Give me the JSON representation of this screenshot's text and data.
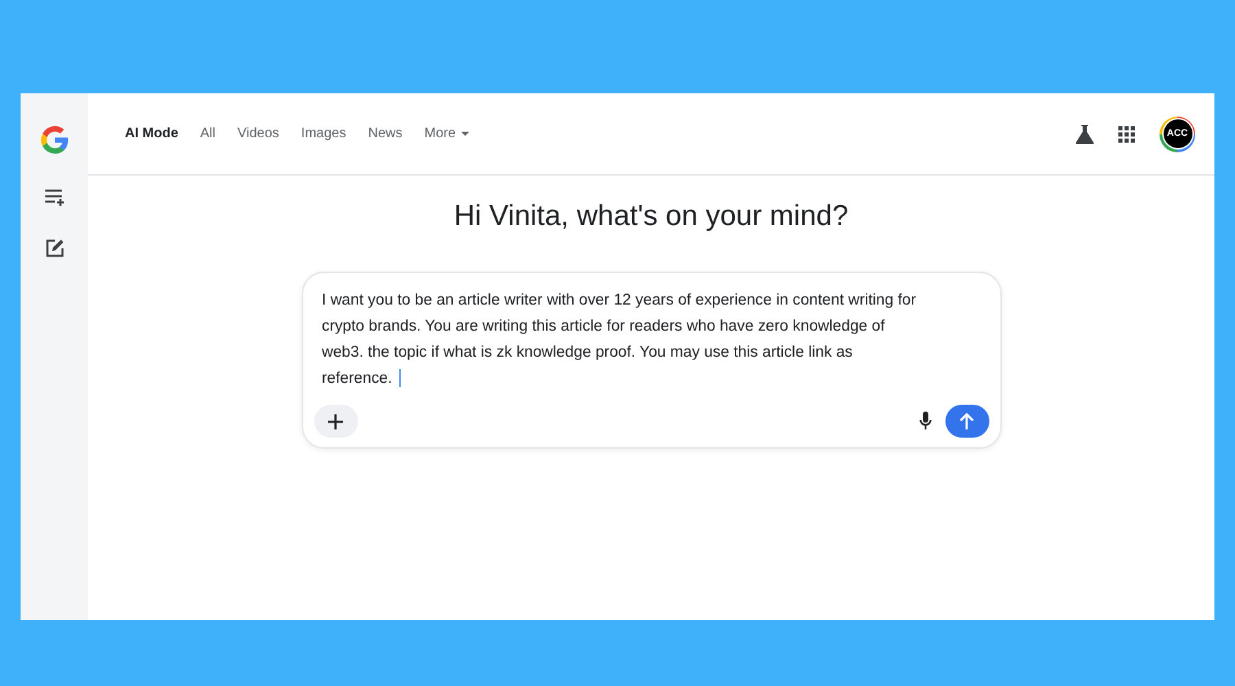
{
  "tabs": [
    {
      "label": "AI Mode",
      "selected": true
    },
    {
      "label": "All",
      "selected": false
    },
    {
      "label": "Videos",
      "selected": false
    },
    {
      "label": "Images",
      "selected": false
    },
    {
      "label": "News",
      "selected": false
    },
    {
      "label": "More",
      "selected": false,
      "dropdown": true
    }
  ],
  "account": {
    "initials": "ACC"
  },
  "greeting": "Hi Vinita, what's on your mind?",
  "prompt": {
    "value": "I want you to be an article writer with over 12 years of experience in content writing for crypto brands. You are writing this article for readers who have zero knowledge of web3. the topic if what is zk knowledge proof. You may use this article link as reference. "
  }
}
